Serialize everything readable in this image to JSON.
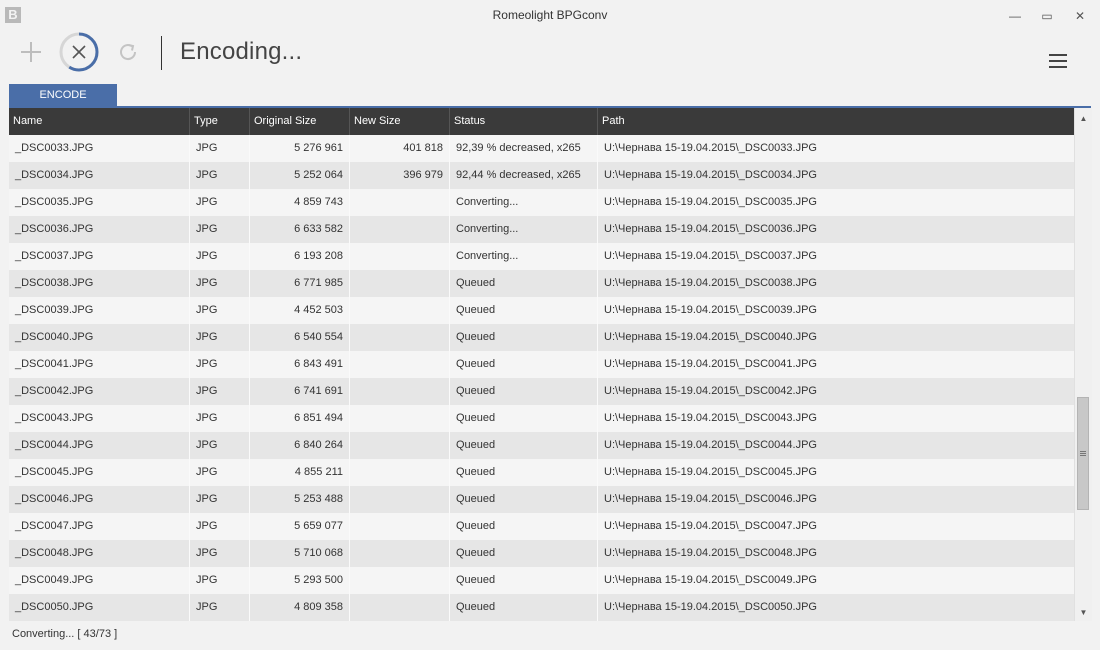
{
  "window": {
    "logo_letter": "B",
    "title": "Romeolight BPGconv",
    "min_glyph": "—",
    "max_glyph": "▭",
    "close_glyph": "✕"
  },
  "toolbar": {
    "status_title": "Encoding...",
    "cancel_progress": 0.59,
    "icons": [
      "plus-icon",
      "cancel-progress-icon",
      "refresh-icon",
      "hamburger-menu-icon"
    ]
  },
  "tabs": [
    {
      "label": "ENCODE",
      "active": true
    }
  ],
  "grid": {
    "columns": [
      "Name",
      "Type",
      "Original Size",
      "New Size",
      "Status",
      "Path"
    ],
    "rows": [
      {
        "name": "_DSC0033.JPG",
        "type": "JPG",
        "original_size": "5 276 961",
        "new_size": "401 818",
        "status": "92,39 % decreased, x265",
        "path": "U:\\Чернава 15-19.04.2015\\_DSC0033.JPG"
      },
      {
        "name": "_DSC0034.JPG",
        "type": "JPG",
        "original_size": "5 252 064",
        "new_size": "396 979",
        "status": "92,44 % decreased, x265",
        "path": "U:\\Чернава 15-19.04.2015\\_DSC0034.JPG"
      },
      {
        "name": "_DSC0035.JPG",
        "type": "JPG",
        "original_size": "4 859 743",
        "new_size": "",
        "status": "Converting...",
        "path": "U:\\Чернава 15-19.04.2015\\_DSC0035.JPG"
      },
      {
        "name": "_DSC0036.JPG",
        "type": "JPG",
        "original_size": "6 633 582",
        "new_size": "",
        "status": "Converting...",
        "path": "U:\\Чернава 15-19.04.2015\\_DSC0036.JPG"
      },
      {
        "name": "_DSC0037.JPG",
        "type": "JPG",
        "original_size": "6 193 208",
        "new_size": "",
        "status": "Converting...",
        "path": "U:\\Чернава 15-19.04.2015\\_DSC0037.JPG"
      },
      {
        "name": "_DSC0038.JPG",
        "type": "JPG",
        "original_size": "6 771 985",
        "new_size": "",
        "status": "Queued",
        "path": "U:\\Чернава 15-19.04.2015\\_DSC0038.JPG"
      },
      {
        "name": "_DSC0039.JPG",
        "type": "JPG",
        "original_size": "4 452 503",
        "new_size": "",
        "status": "Queued",
        "path": "U:\\Чернава 15-19.04.2015\\_DSC0039.JPG"
      },
      {
        "name": "_DSC0040.JPG",
        "type": "JPG",
        "original_size": "6 540 554",
        "new_size": "",
        "status": "Queued",
        "path": "U:\\Чернава 15-19.04.2015\\_DSC0040.JPG"
      },
      {
        "name": "_DSC0041.JPG",
        "type": "JPG",
        "original_size": "6 843 491",
        "new_size": "",
        "status": "Queued",
        "path": "U:\\Чернава 15-19.04.2015\\_DSC0041.JPG"
      },
      {
        "name": "_DSC0042.JPG",
        "type": "JPG",
        "original_size": "6 741 691",
        "new_size": "",
        "status": "Queued",
        "path": "U:\\Чернава 15-19.04.2015\\_DSC0042.JPG"
      },
      {
        "name": "_DSC0043.JPG",
        "type": "JPG",
        "original_size": "6 851 494",
        "new_size": "",
        "status": "Queued",
        "path": "U:\\Чернава 15-19.04.2015\\_DSC0043.JPG"
      },
      {
        "name": "_DSC0044.JPG",
        "type": "JPG",
        "original_size": "6 840 264",
        "new_size": "",
        "status": "Queued",
        "path": "U:\\Чернава 15-19.04.2015\\_DSC0044.JPG"
      },
      {
        "name": "_DSC0045.JPG",
        "type": "JPG",
        "original_size": "4 855 211",
        "new_size": "",
        "status": "Queued",
        "path": "U:\\Чернава 15-19.04.2015\\_DSC0045.JPG"
      },
      {
        "name": "_DSC0046.JPG",
        "type": "JPG",
        "original_size": "5 253 488",
        "new_size": "",
        "status": "Queued",
        "path": "U:\\Чернава 15-19.04.2015\\_DSC0046.JPG"
      },
      {
        "name": "_DSC0047.JPG",
        "type": "JPG",
        "original_size": "5 659 077",
        "new_size": "",
        "status": "Queued",
        "path": "U:\\Чернава 15-19.04.2015\\_DSC0047.JPG"
      },
      {
        "name": "_DSC0048.JPG",
        "type": "JPG",
        "original_size": "5 710 068",
        "new_size": "",
        "status": "Queued",
        "path": "U:\\Чернава 15-19.04.2015\\_DSC0048.JPG"
      },
      {
        "name": "_DSC0049.JPG",
        "type": "JPG",
        "original_size": "5 293 500",
        "new_size": "",
        "status": "Queued",
        "path": "U:\\Чернава 15-19.04.2015\\_DSC0049.JPG"
      },
      {
        "name": "_DSC0050.JPG",
        "type": "JPG",
        "original_size": "4 809 358",
        "new_size": "",
        "status": "Queued",
        "path": "U:\\Чернава 15-19.04.2015\\_DSC0050.JPG"
      }
    ]
  },
  "scrollbar": {
    "up_glyph": "▲",
    "down_glyph": "▼"
  },
  "statusbar": {
    "text": "Converting... [ 43/73 ]"
  },
  "colors": {
    "accent": "#4a6ea8",
    "header_bg": "#3a3a3a",
    "row_odd": "#f5f5f5",
    "row_even": "#e6e6e6"
  }
}
